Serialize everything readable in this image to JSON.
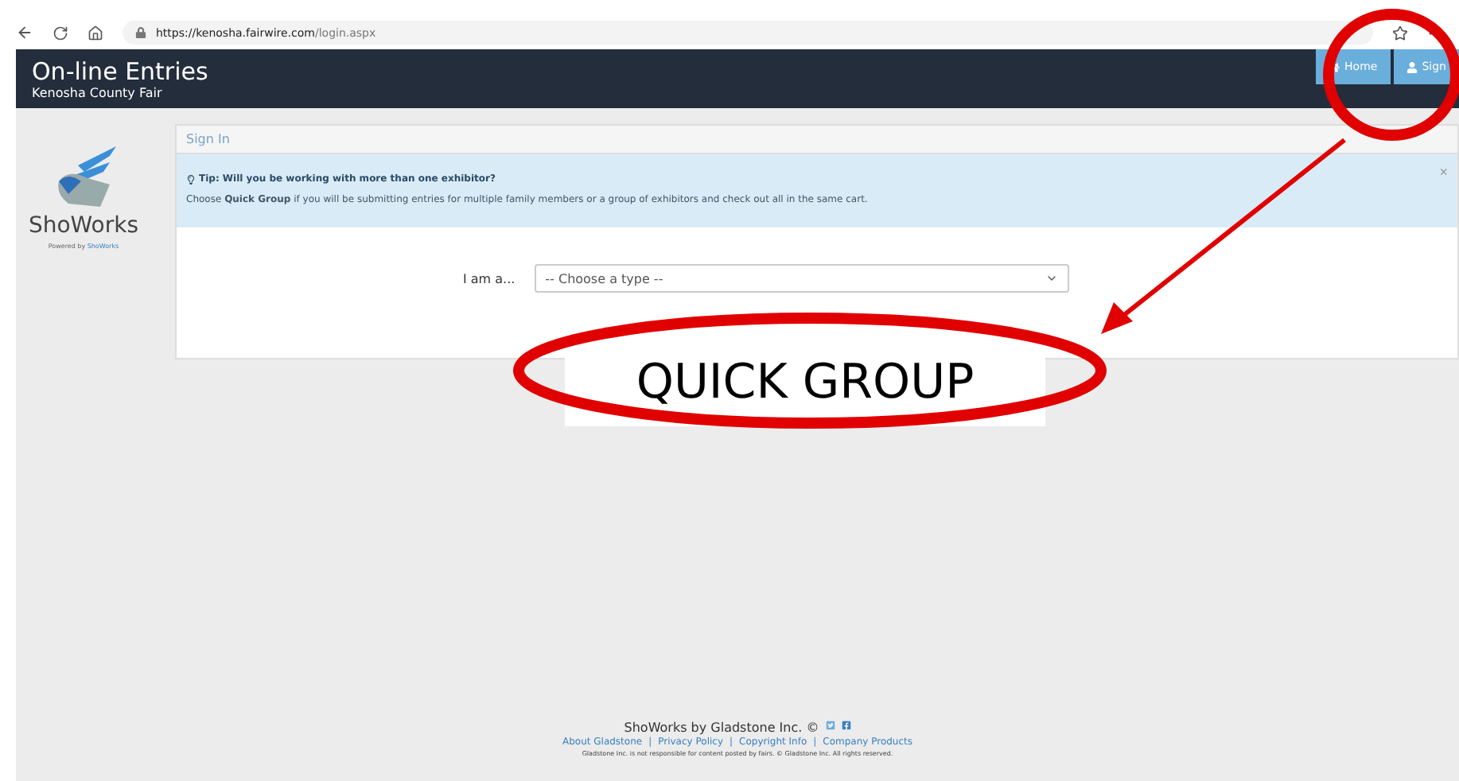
{
  "browser": {
    "url_host": "https://kenosha.fairwire.com",
    "url_path": "/login.aspx"
  },
  "header": {
    "title": "On-line Entries",
    "subtitle": "Kenosha County Fair",
    "nav": [
      {
        "label": "Home",
        "kind": "home"
      },
      {
        "label": "Sign",
        "kind": "user"
      }
    ]
  },
  "sidebar": {
    "logo_text": "ShoWorks",
    "powered_label": "Powered by",
    "powered_link": "ShoWorks"
  },
  "panel": {
    "title": "Sign In",
    "tip": {
      "heading": "Tip: Will you be working with more than one exhibitor?",
      "text": "Choose **Quick Group** if you will be submitting entries for multiple family members or a group of exhibitors and check out all in the same cart.",
      "close": "×"
    },
    "field_label": "I am a...",
    "select_value": "-- Choose a type --"
  },
  "annotation": {
    "label": "QUICK GROUP"
  },
  "footer": {
    "brand": "ShoWorks by Gladstone Inc. ©",
    "links": [
      "About Gladstone",
      "Privacy Policy",
      "Copyright Info",
      "Company Products"
    ],
    "separator": "|",
    "disclaimer": "Gladstone Inc. is not responsible for content posted by fairs. © Gladstone Inc. All rights reserved."
  }
}
